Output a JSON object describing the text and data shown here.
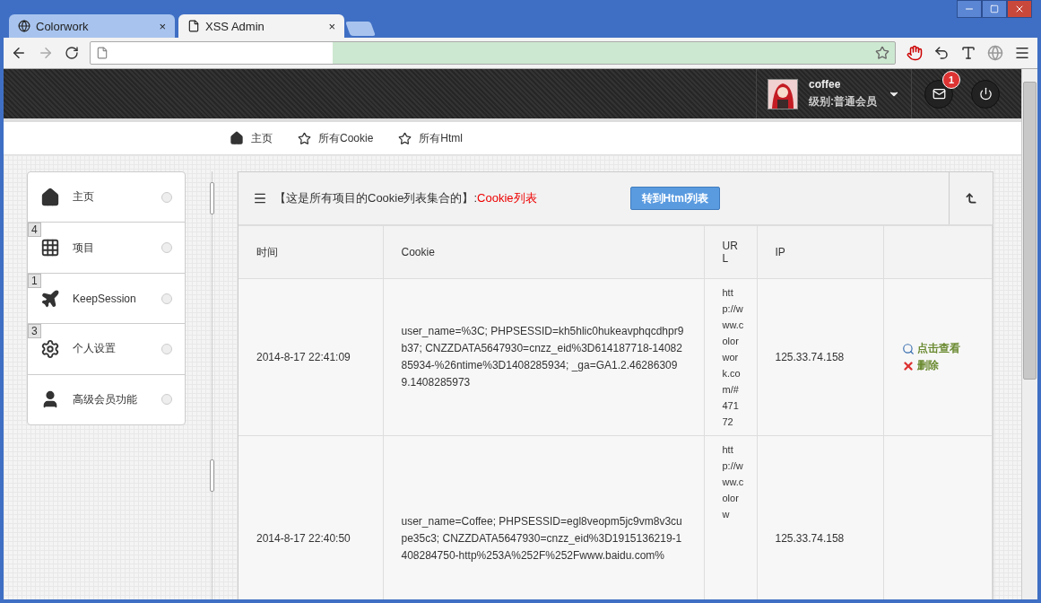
{
  "browser": {
    "tabs": [
      {
        "label": "Colorwork",
        "selected": false,
        "close": "×"
      },
      {
        "label": "XSS Admin",
        "selected": true,
        "close": "×"
      }
    ]
  },
  "header": {
    "user": {
      "name": "coffee",
      "level": "级别:普通会员"
    },
    "mail_badge": "1"
  },
  "nav": [
    {
      "label": "主页",
      "kind": "home"
    },
    {
      "label": "所有Cookie",
      "kind": "star"
    },
    {
      "label": "所有Html",
      "kind": "star"
    }
  ],
  "sidebar": {
    "items": [
      {
        "label": "主页",
        "kind": "home"
      },
      {
        "label": "项目",
        "kind": "grid",
        "badge": "4"
      },
      {
        "label": "KeepSession",
        "kind": "plane",
        "badge": "1"
      },
      {
        "label": "个人设置",
        "kind": "gear",
        "badge": "3"
      },
      {
        "label": "高级会员功能",
        "kind": "user"
      }
    ]
  },
  "panel": {
    "title": "【这是所有项目的Cookie列表集合的】:",
    "title_highlight": "Cookie列表",
    "button": "转到Html列表",
    "table": {
      "columns": [
        "时间",
        "Cookie",
        "URL",
        "IP"
      ],
      "rows": [
        {
          "time": "2014-8-17 22:41:09",
          "cookie": "user_name=%3C; PHPSESSID=kh5hlic0hukeavphqcdhpr9b37; CNZZDATA5647930=cnzz_eid%3D614187718-1408285934-%26ntime%3D1408285934; _ga=GA1.2.462863099.1408285973",
          "url": "http://www.colorwork.com/#47172",
          "ip": "125.33.74.158",
          "actions": [
            "点击查看",
            "删除"
          ]
        },
        {
          "time": "2014-8-17 22:40:50",
          "cookie": "user_name=Coffee; PHPSESSID=egl8veopm5jc9vm8v3cupe35c3; CNZZDATA5647930=cnzz_eid%3D1915136219-1408284750-http%253A%252F%252Fwww.baidu.com%",
          "url": "http://www.colorw",
          "ip": "125.33.74.158"
        }
      ]
    }
  }
}
